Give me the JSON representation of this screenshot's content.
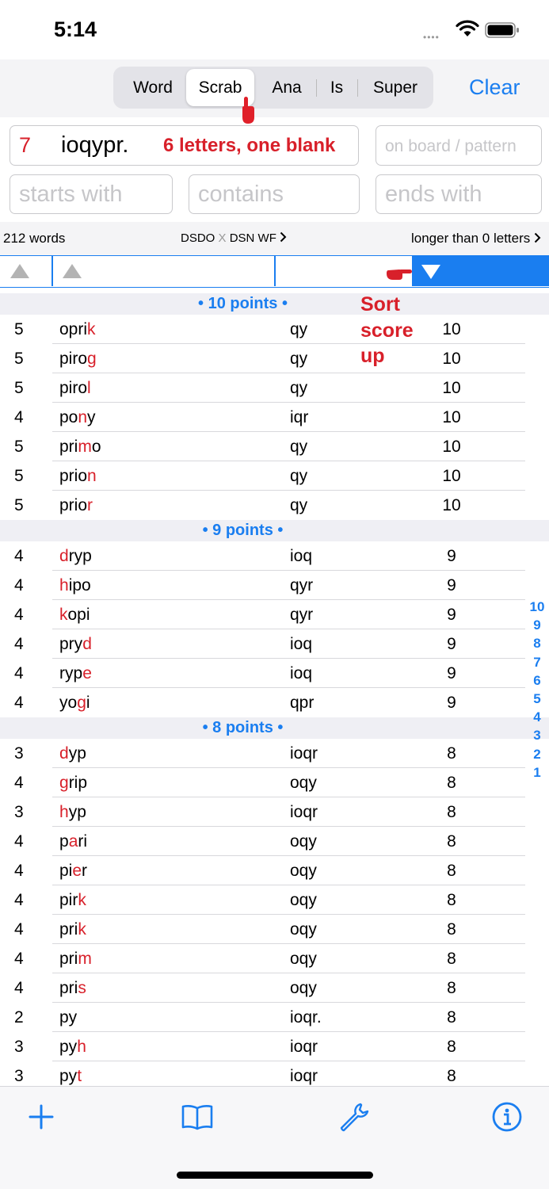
{
  "status_bar": {
    "time": "5:14",
    "signal_dots": "••••"
  },
  "modes": {
    "items": [
      "Word",
      "Scrab",
      "Ana",
      "Is",
      "Super"
    ],
    "active": "Scrab",
    "clear_label": "Clear"
  },
  "search": {
    "rack_count": "7",
    "rack_letters": "ioqypr.",
    "rack_hint": "6 letters, one blank",
    "board_placeholder": "on board / pattern",
    "starts_placeholder": "starts with",
    "contains_placeholder": "contains",
    "ends_placeholder": "ends with"
  },
  "info": {
    "word_count": "212 words",
    "dict_left": "DSDO",
    "dict_x": "X",
    "dict_right": "DSN WF",
    "length_filter": "longer than 0 letters"
  },
  "annotation": {
    "line1": "Sort",
    "line2": "score",
    "line3": "up"
  },
  "sections": [
    {
      "title": "• 10 points •",
      "rows": [
        {
          "len": "5",
          "pre": "opri",
          "hl": "k",
          "post": "",
          "left": "qy",
          "score": "10"
        },
        {
          "len": "5",
          "pre": "piro",
          "hl": "g",
          "post": "",
          "left": "qy",
          "score": "10"
        },
        {
          "len": "5",
          "pre": "piro",
          "hl": "l",
          "post": "",
          "left": "qy",
          "score": "10"
        },
        {
          "len": "4",
          "pre": "po",
          "hl": "n",
          "post": "y",
          "left": "iqr",
          "score": "10"
        },
        {
          "len": "5",
          "pre": "pri",
          "hl": "m",
          "post": "o",
          "left": "qy",
          "score": "10"
        },
        {
          "len": "5",
          "pre": "prio",
          "hl": "n",
          "post": "",
          "left": "qy",
          "score": "10"
        },
        {
          "len": "5",
          "pre": "prio",
          "hl": "r",
          "post": "",
          "left": "qy",
          "score": "10"
        }
      ]
    },
    {
      "title": "• 9 points •",
      "rows": [
        {
          "len": "4",
          "pre": "",
          "hl": "d",
          "post": "ryp",
          "left": "ioq",
          "score": "9"
        },
        {
          "len": "4",
          "pre": "",
          "hl": "h",
          "post": "ipo",
          "left": "qyr",
          "score": "9"
        },
        {
          "len": "4",
          "pre": "",
          "hl": "k",
          "post": "opi",
          "left": "qyr",
          "score": "9"
        },
        {
          "len": "4",
          "pre": "pry",
          "hl": "d",
          "post": "",
          "left": "ioq",
          "score": "9"
        },
        {
          "len": "4",
          "pre": "ryp",
          "hl": "e",
          "post": "",
          "left": "ioq",
          "score": "9"
        },
        {
          "len": "4",
          "pre": "yo",
          "hl": "g",
          "post": "i",
          "left": "qpr",
          "score": "9"
        }
      ]
    },
    {
      "title": "• 8 points •",
      "rows": [
        {
          "len": "3",
          "pre": "",
          "hl": "d",
          "post": "yp",
          "left": "ioqr",
          "score": "8"
        },
        {
          "len": "4",
          "pre": "",
          "hl": "g",
          "post": "rip",
          "left": "oqy",
          "score": "8"
        },
        {
          "len": "3",
          "pre": "",
          "hl": "h",
          "post": "yp",
          "left": "ioqr",
          "score": "8"
        },
        {
          "len": "4",
          "pre": "p",
          "hl": "a",
          "post": "ri",
          "left": "oqy",
          "score": "8"
        },
        {
          "len": "4",
          "pre": "pi",
          "hl": "e",
          "post": "r",
          "left": "oqy",
          "score": "8"
        },
        {
          "len": "4",
          "pre": "pir",
          "hl": "k",
          "post": "",
          "left": "oqy",
          "score": "8"
        },
        {
          "len": "4",
          "pre": "pri",
          "hl": "k",
          "post": "",
          "left": "oqy",
          "score": "8"
        },
        {
          "len": "4",
          "pre": "pri",
          "hl": "m",
          "post": "",
          "left": "oqy",
          "score": "8"
        },
        {
          "len": "4",
          "pre": "pri",
          "hl": "s",
          "post": "",
          "left": "oqy",
          "score": "8"
        },
        {
          "len": "2",
          "pre": "py",
          "hl": "",
          "post": "",
          "left": "ioqr.",
          "score": "8"
        },
        {
          "len": "3",
          "pre": "py",
          "hl": "h",
          "post": "",
          "left": "ioqr",
          "score": "8"
        },
        {
          "len": "3",
          "pre": "py",
          "hl": "t",
          "post": "",
          "left": "ioqr",
          "score": "8"
        }
      ]
    }
  ],
  "score_index": [
    "10",
    "9",
    "8",
    "7",
    "6",
    "5",
    "4",
    "3",
    "2",
    "1"
  ],
  "toolbar": {
    "icons": [
      "plus-icon",
      "book-icon",
      "wrench-icon",
      "info-icon"
    ]
  },
  "colors": {
    "accent": "#1a7ef0",
    "highlight": "#d8202a",
    "section_bg": "#efeff4"
  }
}
